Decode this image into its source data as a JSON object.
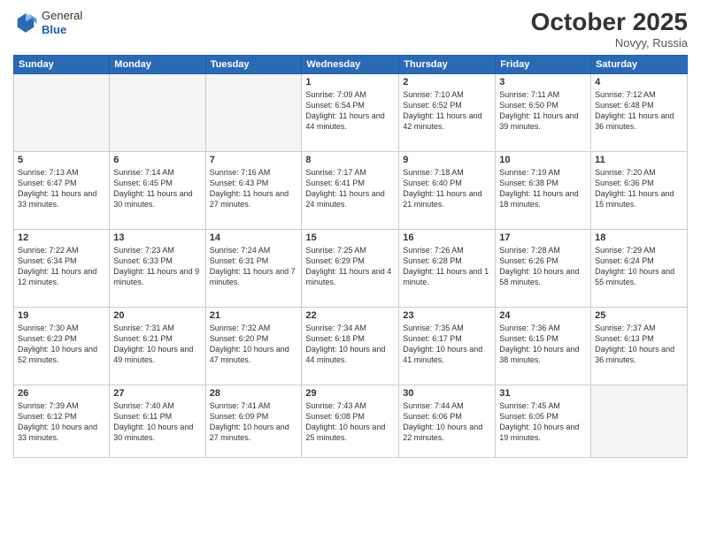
{
  "header": {
    "logo_line1": "General",
    "logo_line2": "Blue",
    "month": "October 2025",
    "location": "Novyy, Russia"
  },
  "weekdays": [
    "Sunday",
    "Monday",
    "Tuesday",
    "Wednesday",
    "Thursday",
    "Friday",
    "Saturday"
  ],
  "weeks": [
    [
      {
        "day": "",
        "info": ""
      },
      {
        "day": "",
        "info": ""
      },
      {
        "day": "",
        "info": ""
      },
      {
        "day": "1",
        "info": "Sunrise: 7:09 AM\nSunset: 6:54 PM\nDaylight: 11 hours and 44 minutes."
      },
      {
        "day": "2",
        "info": "Sunrise: 7:10 AM\nSunset: 6:52 PM\nDaylight: 11 hours and 42 minutes."
      },
      {
        "day": "3",
        "info": "Sunrise: 7:11 AM\nSunset: 6:50 PM\nDaylight: 11 hours and 39 minutes."
      },
      {
        "day": "4",
        "info": "Sunrise: 7:12 AM\nSunset: 6:48 PM\nDaylight: 11 hours and 36 minutes."
      }
    ],
    [
      {
        "day": "5",
        "info": "Sunrise: 7:13 AM\nSunset: 6:47 PM\nDaylight: 11 hours and 33 minutes."
      },
      {
        "day": "6",
        "info": "Sunrise: 7:14 AM\nSunset: 6:45 PM\nDaylight: 11 hours and 30 minutes."
      },
      {
        "day": "7",
        "info": "Sunrise: 7:16 AM\nSunset: 6:43 PM\nDaylight: 11 hours and 27 minutes."
      },
      {
        "day": "8",
        "info": "Sunrise: 7:17 AM\nSunset: 6:41 PM\nDaylight: 11 hours and 24 minutes."
      },
      {
        "day": "9",
        "info": "Sunrise: 7:18 AM\nSunset: 6:40 PM\nDaylight: 11 hours and 21 minutes."
      },
      {
        "day": "10",
        "info": "Sunrise: 7:19 AM\nSunset: 6:38 PM\nDaylight: 11 hours and 18 minutes."
      },
      {
        "day": "11",
        "info": "Sunrise: 7:20 AM\nSunset: 6:36 PM\nDaylight: 11 hours and 15 minutes."
      }
    ],
    [
      {
        "day": "12",
        "info": "Sunrise: 7:22 AM\nSunset: 6:34 PM\nDaylight: 11 hours and 12 minutes."
      },
      {
        "day": "13",
        "info": "Sunrise: 7:23 AM\nSunset: 6:33 PM\nDaylight: 11 hours and 9 minutes."
      },
      {
        "day": "14",
        "info": "Sunrise: 7:24 AM\nSunset: 6:31 PM\nDaylight: 11 hours and 7 minutes."
      },
      {
        "day": "15",
        "info": "Sunrise: 7:25 AM\nSunset: 6:29 PM\nDaylight: 11 hours and 4 minutes."
      },
      {
        "day": "16",
        "info": "Sunrise: 7:26 AM\nSunset: 6:28 PM\nDaylight: 11 hours and 1 minute."
      },
      {
        "day": "17",
        "info": "Sunrise: 7:28 AM\nSunset: 6:26 PM\nDaylight: 10 hours and 58 minutes."
      },
      {
        "day": "18",
        "info": "Sunrise: 7:29 AM\nSunset: 6:24 PM\nDaylight: 10 hours and 55 minutes."
      }
    ],
    [
      {
        "day": "19",
        "info": "Sunrise: 7:30 AM\nSunset: 6:23 PM\nDaylight: 10 hours and 52 minutes."
      },
      {
        "day": "20",
        "info": "Sunrise: 7:31 AM\nSunset: 6:21 PM\nDaylight: 10 hours and 49 minutes."
      },
      {
        "day": "21",
        "info": "Sunrise: 7:32 AM\nSunset: 6:20 PM\nDaylight: 10 hours and 47 minutes."
      },
      {
        "day": "22",
        "info": "Sunrise: 7:34 AM\nSunset: 6:18 PM\nDaylight: 10 hours and 44 minutes."
      },
      {
        "day": "23",
        "info": "Sunrise: 7:35 AM\nSunset: 6:17 PM\nDaylight: 10 hours and 41 minutes."
      },
      {
        "day": "24",
        "info": "Sunrise: 7:36 AM\nSunset: 6:15 PM\nDaylight: 10 hours and 38 minutes."
      },
      {
        "day": "25",
        "info": "Sunrise: 7:37 AM\nSunset: 6:13 PM\nDaylight: 10 hours and 36 minutes."
      }
    ],
    [
      {
        "day": "26",
        "info": "Sunrise: 7:39 AM\nSunset: 6:12 PM\nDaylight: 10 hours and 33 minutes."
      },
      {
        "day": "27",
        "info": "Sunrise: 7:40 AM\nSunset: 6:11 PM\nDaylight: 10 hours and 30 minutes."
      },
      {
        "day": "28",
        "info": "Sunrise: 7:41 AM\nSunset: 6:09 PM\nDaylight: 10 hours and 27 minutes."
      },
      {
        "day": "29",
        "info": "Sunrise: 7:43 AM\nSunset: 6:08 PM\nDaylight: 10 hours and 25 minutes."
      },
      {
        "day": "30",
        "info": "Sunrise: 7:44 AM\nSunset: 6:06 PM\nDaylight: 10 hours and 22 minutes."
      },
      {
        "day": "31",
        "info": "Sunrise: 7:45 AM\nSunset: 6:05 PM\nDaylight: 10 hours and 19 minutes."
      },
      {
        "day": "",
        "info": ""
      }
    ]
  ]
}
